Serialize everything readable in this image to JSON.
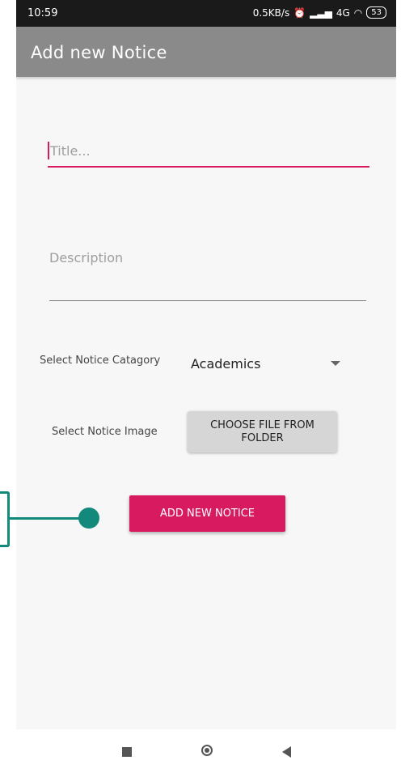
{
  "status_bar": {
    "time": "10:59",
    "network_speed": "0.5KB/s",
    "signal_text": "4G",
    "battery": "53"
  },
  "app_bar": {
    "title": "Add new Notice"
  },
  "form": {
    "title_placeholder": "Title...",
    "description_placeholder": "Description",
    "category_label": "Select Notice Catagory",
    "category_value": "Academics",
    "image_label": "Select Notice Image",
    "choose_file_label": "CHOOSE FILE FROM FOLDER",
    "submit_label": "ADD NEW NOTICE"
  },
  "colors": {
    "accent": "#d81b60",
    "app_bar": "#8a8a8a",
    "annotation": "#13897b"
  },
  "icons": [
    "alarm-icon",
    "signal-icon",
    "volte-icon",
    "wifi-icon",
    "battery-icon",
    "dropdown-arrow-icon",
    "nav-recents-icon",
    "nav-home-icon",
    "nav-back-icon"
  ]
}
